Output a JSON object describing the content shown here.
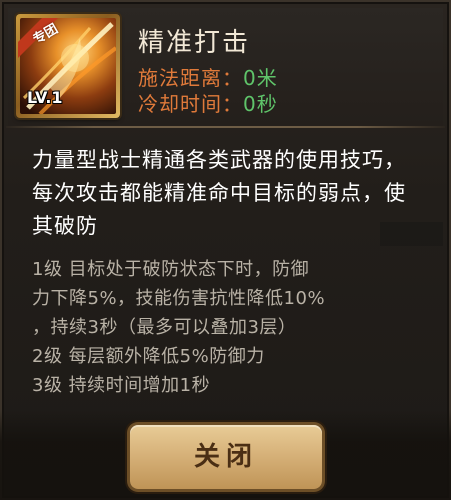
{
  "skill": {
    "badge": "专团",
    "level": "LV.1",
    "name": "精准打击",
    "cast_range_label": "施法距离：",
    "cast_range_value": "0米",
    "cooldown_label": "冷却时间：",
    "cooldown_value": "0秒"
  },
  "description": "力量型战士精通各类武器的使用技巧，每次攻击都能精准命中目标的弱点，使其破防",
  "effects": [
    "1级 目标处于破防状态下时，防御",
    "力下降5%，技能伤害抗性降低10%",
    "，持续3秒（最多可以叠加3层）",
    "2级 每层额外降低5%防御力",
    "3级 持续时间增加1秒"
  ],
  "buttons": {
    "close_label": "关闭"
  },
  "colors": {
    "stat_label": "#e07a3a",
    "stat_value": "#5fc46a",
    "button_face": "#d7b27a",
    "panel_bg": "#221e1a"
  },
  "icons": {
    "skill": "flaming-sword-strike-icon"
  }
}
